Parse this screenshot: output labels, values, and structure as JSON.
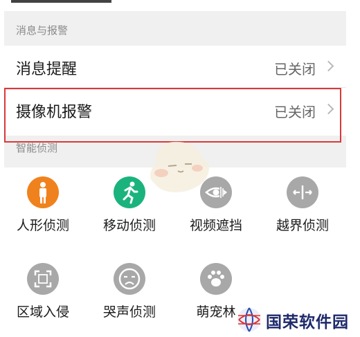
{
  "section_messages": {
    "title": "消息与报警"
  },
  "rows": [
    {
      "label": "消息提醒",
      "value": "已关闭"
    },
    {
      "label": "摄像机报警",
      "value": "已关闭"
    }
  ],
  "section_detection": {
    "title": "智能侦测"
  },
  "detections": [
    {
      "label": "人形侦测",
      "icon": "person-icon",
      "color": "#f0821e"
    },
    {
      "label": "移动侦测",
      "icon": "running-icon",
      "color": "#1bb37d"
    },
    {
      "label": "视频遮挡",
      "icon": "eye-block-icon",
      "color": "#a8a8a8"
    },
    {
      "label": "越界侦测",
      "icon": "boundary-arrows-icon",
      "color": "#a8a8a8"
    },
    {
      "label": "区域入侵",
      "icon": "area-frame-icon",
      "color": "#a8a8a8"
    },
    {
      "label": "哭声侦测",
      "icon": "crying-face-icon",
      "color": "#a8a8a8"
    },
    {
      "label": "萌宠林",
      "icon": "paw-icon",
      "color": "#a8a8a8"
    }
  ],
  "watermark": {
    "text": "国荣软件园"
  },
  "colors": {
    "highlight_border": "#d9383a",
    "section_bg": "#f0f0f0"
  }
}
